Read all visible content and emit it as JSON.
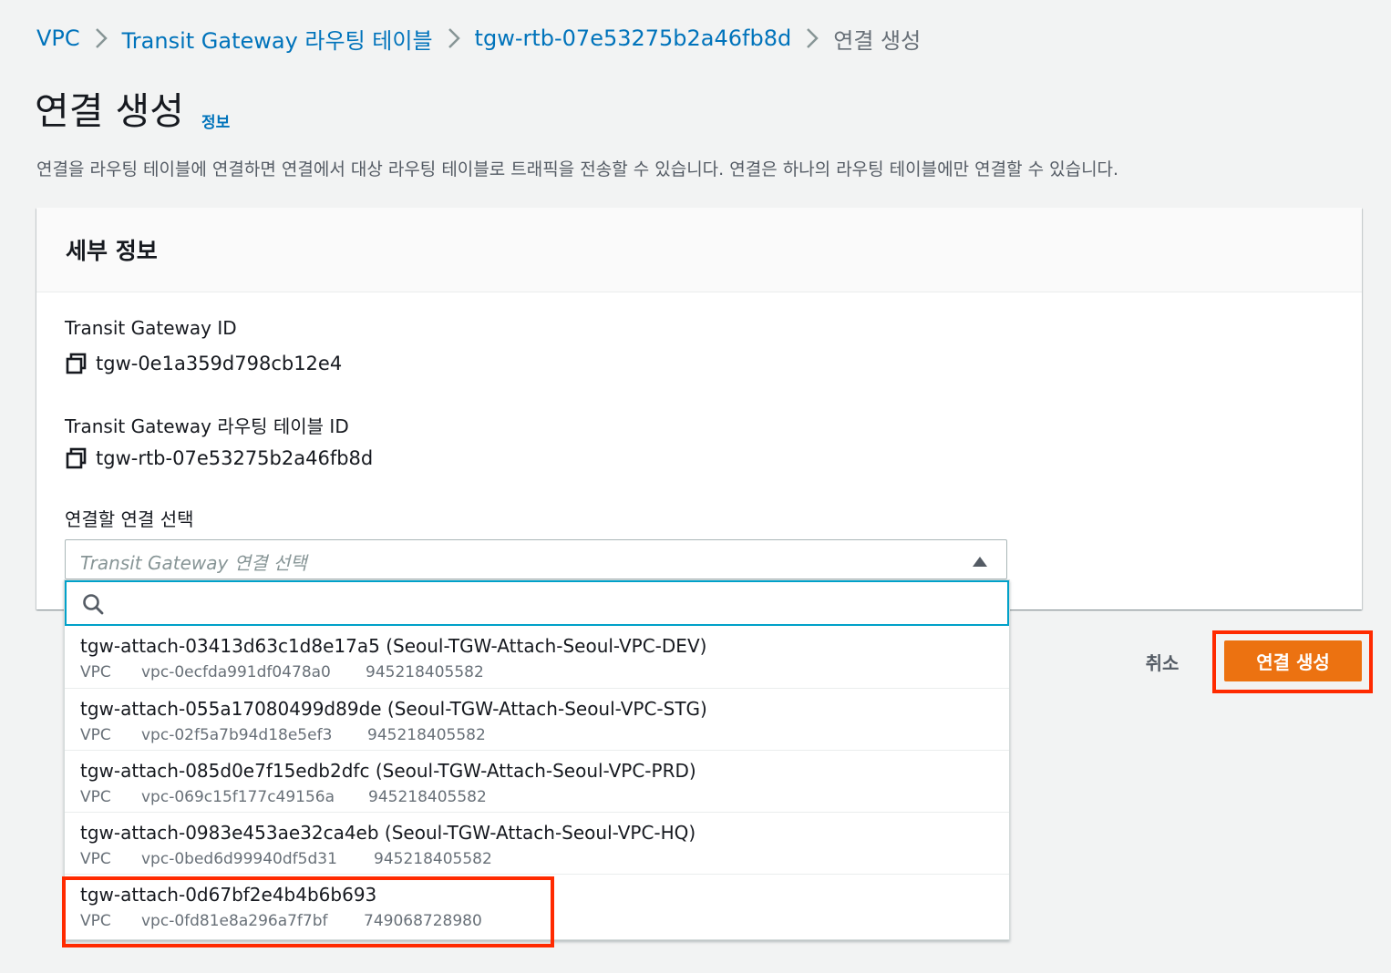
{
  "breadcrumb": {
    "items": [
      {
        "label": "VPC"
      },
      {
        "label": "Transit Gateway 라우팅 테이블"
      },
      {
        "label": "tgw-rtb-07e53275b2a46fb8d"
      },
      {
        "label": "연결 생성"
      }
    ]
  },
  "header": {
    "title": "연결 생성",
    "info_link": "정보",
    "description": "연결을 라우팅 테이블에 연결하면 연결에서 대상 라우팅 테이블로 트래픽을 전송할 수 있습니다. 연결은 하나의 라우팅 테이블에만 연결할 수 있습니다."
  },
  "details": {
    "title": "세부 정보",
    "tgw_id_label": "Transit Gateway ID",
    "tgw_id_value": "tgw-0e1a359d798cb12e4",
    "rtb_id_label": "Transit Gateway 라우팅 테이블 ID",
    "rtb_id_value": "tgw-rtb-07e53275b2a46fb8d",
    "select_label": "연결할 연결 선택",
    "select_placeholder": "Transit Gateway 연결 선택",
    "search_placeholder": ""
  },
  "options": [
    {
      "title": "tgw-attach-03413d63c1d8e17a5 (Seoul-TGW-Attach-Seoul-VPC-DEV)",
      "type": "VPC",
      "vpc": "vpc-0ecfda991df0478a0",
      "account": "945218405582"
    },
    {
      "title": "tgw-attach-055a17080499d89de (Seoul-TGW-Attach-Seoul-VPC-STG)",
      "type": "VPC",
      "vpc": "vpc-02f5a7b94d18e5ef3",
      "account": "945218405582"
    },
    {
      "title": "tgw-attach-085d0e7f15edb2dfc (Seoul-TGW-Attach-Seoul-VPC-PRD)",
      "type": "VPC",
      "vpc": "vpc-069c15f177c49156a",
      "account": "945218405582"
    },
    {
      "title": "tgw-attach-0983e453ae32ca4eb (Seoul-TGW-Attach-Seoul-VPC-HQ)",
      "type": "VPC",
      "vpc": "vpc-0bed6d99940df5d31",
      "account": "945218405582"
    },
    {
      "title": "tgw-attach-0d67bf2e4b4b6b693",
      "type": "VPC",
      "vpc": "vpc-0fd81e8a296a7f7bf",
      "account": "749068728980"
    }
  ],
  "actions": {
    "cancel": "취소",
    "create": "연결 생성"
  },
  "colors": {
    "link": "#0073bb",
    "primary_button": "#ec7211",
    "highlight": "#ff2a00",
    "focus": "#00a1c9"
  },
  "icons": {
    "breadcrumb_separator": "chevron-right-icon",
    "copy": "copy-icon",
    "caret": "caret-up-icon",
    "search": "search-icon"
  }
}
